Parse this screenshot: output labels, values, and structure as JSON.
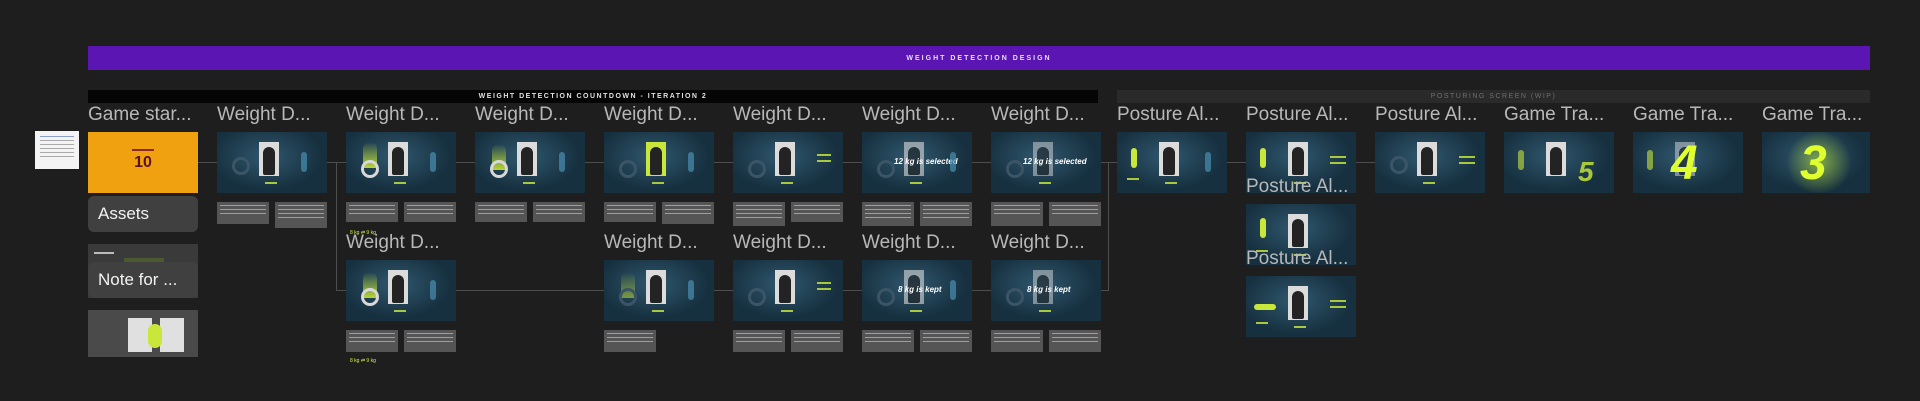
{
  "banner": {
    "title": "WEIGHT DETECTION DESIGN"
  },
  "sections": {
    "countdown": "WEIGHT DETECTION COUNTDOWN - ITERATION 2",
    "posturing": "POSTURING SCREEN (WIP)"
  },
  "left": {
    "game_start_label": "Game star...",
    "game_start_number": "10",
    "assets_label": "Assets",
    "note_label": "Note for ..."
  },
  "frames_row1": [
    {
      "label": "Weight D..."
    },
    {
      "label": "Weight D..."
    },
    {
      "label": "Weight D..."
    },
    {
      "label": "Weight D..."
    },
    {
      "label": "Weight D..."
    },
    {
      "label": "Weight D...",
      "overlay": "12 kg is selected"
    },
    {
      "label": "Weight D...",
      "overlay": "12 kg is selected"
    },
    {
      "label": "Posture Al..."
    },
    {
      "label": "Posture Al..."
    },
    {
      "label": "Posture Al..."
    },
    {
      "label": "Game Tra...",
      "countdown": "5"
    },
    {
      "label": "Game Tra...",
      "countdown": "4"
    },
    {
      "label": "Game Tra...",
      "countdown": "3"
    }
  ],
  "frames_row2": [
    {
      "label": "Weight D..."
    },
    {
      "label": "Weight D..."
    },
    {
      "label": "Weight D..."
    },
    {
      "label": "Weight D...",
      "overlay": "8 kg is kept"
    },
    {
      "label": "Weight D...",
      "overlay": "8 kg is kept"
    }
  ],
  "posture_extra": [
    {
      "label": "Posture Al..."
    },
    {
      "label": "Posture Al..."
    }
  ],
  "weights": {
    "a": "8 kg",
    "b": "9 kg",
    "c": "8 kg",
    "d": "9 kg"
  },
  "colors": {
    "banner": "#5b15b3",
    "accent": "#dfff2e",
    "orange": "#f0a10f",
    "frame_bg": "#16303f"
  }
}
